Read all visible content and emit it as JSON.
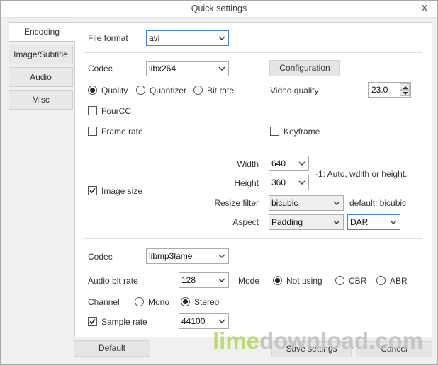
{
  "window": {
    "title": "Quick settings",
    "close_label": "X"
  },
  "tabs": [
    "Encoding",
    "Image/Subtitle",
    "Audio",
    "Misc"
  ],
  "format": {
    "label": "File format",
    "value": "avi"
  },
  "video": {
    "codec_label": "Codec",
    "codec_value": "libx264",
    "config_button": "Configuration",
    "rate_modes": [
      "Quality",
      "Quantizer",
      "Bit rate"
    ],
    "selected_mode": "Quality",
    "quality_label": "Video quality",
    "quality_value": "23.0",
    "fourcc_label": "FourCC",
    "framerate_label": "Frame rate",
    "keyframe_label": "Keyframe"
  },
  "image": {
    "image_size_label": "Image size",
    "image_size_checked": true,
    "width_label": "Width",
    "width_value": "640",
    "height_label": "Height",
    "height_value": "360",
    "size_hint": "-1: Auto, wdith or height.",
    "resize_label": "Resize filter",
    "resize_value": "bicubic",
    "resize_hint": "default: bicubic",
    "aspect_label": "Aspect",
    "aspect_mode": "Padding",
    "aspect_type": "DAR"
  },
  "audio": {
    "codec_label": "Codec",
    "codec_value": "libmp3lame",
    "bitrate_label": "Audio bit rate",
    "bitrate_value": "128",
    "mode_label": "Mode",
    "modes": [
      "Not using",
      "CBR",
      "ABR"
    ],
    "selected_mode": "Not using",
    "channel_label": "Channel",
    "channels": [
      "Mono",
      "Stereo"
    ],
    "selected_channel": "Stereo",
    "samplerate_label": "Sample rate",
    "samplerate_checked": true,
    "samplerate_value": "44100"
  },
  "footer": {
    "default_button": "Default",
    "save_button": "Save settings",
    "cancel_button": "Cancel"
  },
  "watermark": {
    "part1": "lime",
    "part2": "download.com"
  },
  "colors": {
    "focus_border": "#3f84d3",
    "watermark_green": "#b7d96b",
    "watermark_gray": "#c2c2c2"
  }
}
